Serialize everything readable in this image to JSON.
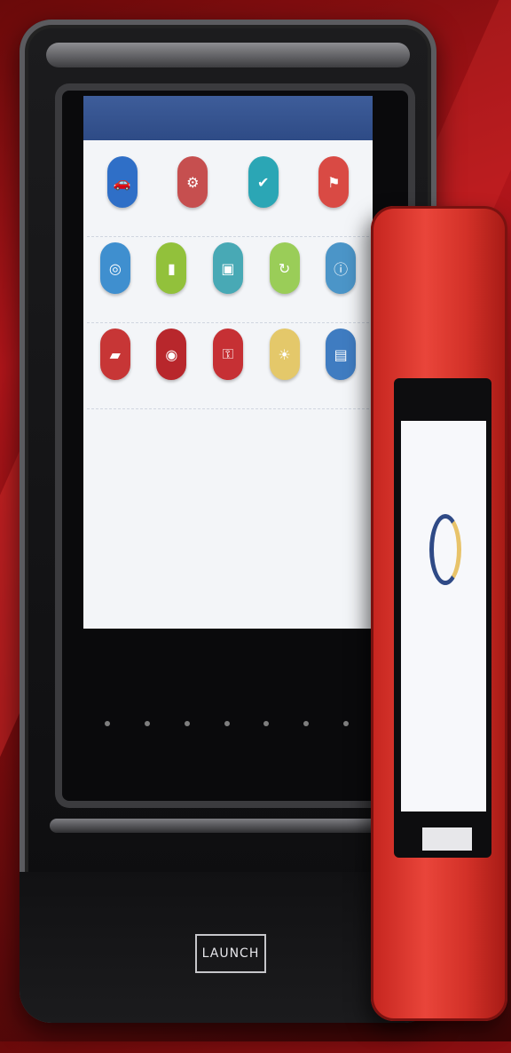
{
  "tablet": {
    "topbar": {
      "title": "",
      "icons": ""
    },
    "apps": [
      [
        {
          "icon": "car-icon",
          "color": "#2f6fc7",
          "glyph": "🚗",
          "label": ""
        },
        {
          "icon": "tool-icon",
          "color": "#c64f4f",
          "glyph": "⚙",
          "label": ""
        },
        {
          "icon": "service-icon",
          "color": "#2ba6b5",
          "glyph": "✔",
          "label": ""
        },
        {
          "icon": "report-icon",
          "color": "#d94a44",
          "glyph": "⚑",
          "label": ""
        }
      ],
      [
        {
          "icon": "globe-icon",
          "color": "#3f8fcf",
          "glyph": "◎",
          "label": ""
        },
        {
          "icon": "battery-icon",
          "color": "#92c13b",
          "glyph": "▮",
          "label": ""
        },
        {
          "icon": "scan-icon",
          "color": "#48a9b5",
          "glyph": "▣",
          "label": ""
        },
        {
          "icon": "update-icon",
          "color": "#9acd58",
          "glyph": "↻",
          "label": ""
        },
        {
          "icon": "info-icon",
          "color": "#4b95c8",
          "glyph": "ⓘ",
          "label": ""
        }
      ],
      [
        {
          "icon": "oil-icon",
          "color": "#c73636",
          "glyph": "▰",
          "label": ""
        },
        {
          "icon": "brake-icon",
          "color": "#b8272c",
          "glyph": "◉",
          "label": ""
        },
        {
          "icon": "key-icon",
          "color": "#c63034",
          "glyph": "⚿",
          "label": ""
        },
        {
          "icon": "light-icon",
          "color": "#e4c86a",
          "glyph": "☀",
          "label": ""
        },
        {
          "icon": "data-icon",
          "color": "#3f7cc1",
          "glyph": "▤",
          "label": ""
        }
      ]
    ],
    "brand": "LAUNCH"
  },
  "handheld": {
    "screen_text": "",
    "label": ""
  }
}
